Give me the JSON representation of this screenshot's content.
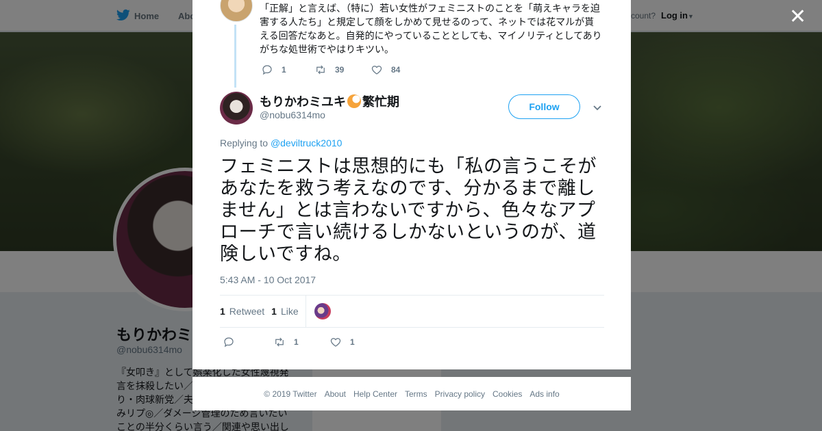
{
  "nav": {
    "home": "Home",
    "about": "Abo",
    "account_prompt": "ccount?",
    "login": "Log in"
  },
  "profile": {
    "name": "もりかわミ",
    "handle": "@nobu6314mo",
    "bio": [
      "『女叩き』として娯楽化した女性蔑視発",
      "言を抹殺したい／",
      "り・肉球新党／夫",
      "みリプ◎／ダメージ管理のため言いたい",
      "ことの半分くらい言う／関連や思い出し"
    ]
  },
  "close_label": "✕",
  "parent_tweet": {
    "text": "「正解」と言えば、（特に）若い女性がフェミニストのことを「萌えキャラを迫害する人たち」と規定して顔をしかめて見せるのって、ネットでは花マルが貰える回答だなあと。自発的にやっていることとしても、マイノリティとしてありがちな処世術でやはりキツい。",
    "replies": "1",
    "retweets": "39",
    "likes": "84"
  },
  "tweet": {
    "author_name": "もりかわミユキ",
    "author_name_suffix": "繁忙期",
    "author_handle": "@nobu6314mo",
    "follow_label": "Follow",
    "replying_prefix": "Replying to ",
    "replying_to": "@deviltruck2010",
    "text": "フェミニストは思想的にも「私の言うこそがあなたを救う考えなのです、分かるまで離しません」とは言わないですから、色々なアプローチで言い続けるしかないというのが、道険しいですね。",
    "timestamp": "5:43 AM - 10 Oct 2017",
    "retweet_count": "1",
    "retweet_label": "Retweet",
    "like_count": "1",
    "like_label": "Like",
    "action_retweets": "1",
    "action_likes": "1"
  },
  "footer": [
    "© 2019 Twitter",
    "About",
    "Help Center",
    "Terms",
    "Privacy policy",
    "Cookies",
    "Ads info"
  ],
  "colors": {
    "accent": "#1da1f2",
    "muted": "#657786",
    "thread": "#c3e2f6"
  }
}
